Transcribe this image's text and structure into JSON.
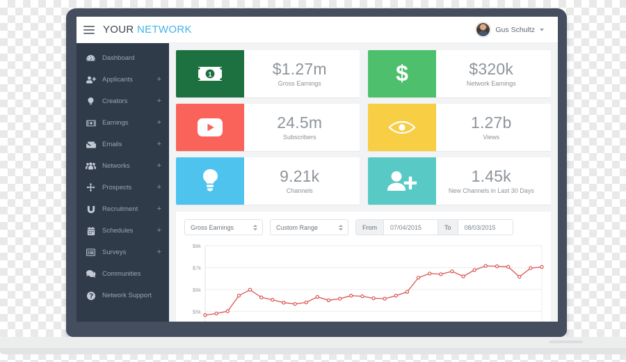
{
  "topbar": {
    "menu_icon": "hamburger-icon",
    "brand_primary": "YOUR",
    "brand_secondary": "NETWORK",
    "user_name": "Gus Schultz",
    "caret_icon": "chevron-down-icon"
  },
  "sidebar": {
    "items": [
      {
        "label": "Dashboard",
        "icon": "dashboard-icon",
        "expand": ""
      },
      {
        "label": "Applicants",
        "icon": "user-plus-icon",
        "expand": "+"
      },
      {
        "label": "Creators",
        "icon": "bulb-icon",
        "expand": "+"
      },
      {
        "label": "Earnings",
        "icon": "money-icon",
        "expand": "+"
      },
      {
        "label": "Emails",
        "icon": "envelope-icon",
        "expand": "+"
      },
      {
        "label": "Networks",
        "icon": "group-icon",
        "expand": "+"
      },
      {
        "label": "Prospects",
        "icon": "move-icon",
        "expand": "+"
      },
      {
        "label": "Recruitment",
        "icon": "magnet-icon",
        "expand": "+"
      },
      {
        "label": "Schedules",
        "icon": "calendar-icon",
        "expand": "+"
      },
      {
        "label": "Surveys",
        "icon": "list-alt-icon",
        "expand": "+"
      },
      {
        "label": "Communities",
        "icon": "comments-icon",
        "expand": ""
      },
      {
        "label": "Network Support",
        "icon": "question-icon",
        "expand": ""
      }
    ]
  },
  "cards": [
    {
      "value": "$1.27m",
      "label": "Gross Earnings",
      "icon": "money-bill-icon",
      "color": "#1d7141"
    },
    {
      "value": "$320k",
      "label": "Network Earnings",
      "icon": "dollar-icon",
      "color": "#4ec06d"
    },
    {
      "value": "24.5m",
      "label": "Subscribers",
      "icon": "youtube-icon",
      "color": "#fa6359"
    },
    {
      "value": "1.27b",
      "label": "Views",
      "icon": "eye-icon",
      "color": "#f7ce44"
    },
    {
      "value": "9.21k",
      "label": "Channels",
      "icon": "bulb-icon",
      "color": "#4ec3ee"
    },
    {
      "value": "1.45k",
      "label": "New Channels in Last 30 Days",
      "icon": "user-plus-icon",
      "color": "#58c9c4"
    }
  ],
  "filters": {
    "metric_value": "Gross Earnings",
    "range_value": "Custom Range",
    "from_label": "From",
    "from_value": "07/04/2015",
    "to_label": "To",
    "to_value": "08/03/2015"
  },
  "chart_data": {
    "type": "line",
    "title": "",
    "xlabel": "",
    "ylabel": "",
    "ylim": [
      4500,
      8000
    ],
    "grid": true,
    "legend": "none",
    "line_color": "#d9534f",
    "ytick_labels": [
      "$5k",
      "$6k",
      "$7k",
      "$8k"
    ],
    "ytick_values": [
      5000,
      6000,
      7000,
      8000
    ],
    "x": [
      1,
      2,
      3,
      4,
      5,
      6,
      7,
      8,
      9,
      10,
      11,
      12,
      13,
      14,
      15,
      16,
      17,
      18,
      19,
      20,
      21,
      22,
      23,
      24,
      25,
      26,
      27,
      28,
      29,
      30,
      31
    ],
    "series": [
      {
        "name": "Gross Earnings",
        "values": [
          4830,
          4900,
          5010,
          5720,
          5990,
          5640,
          5530,
          5400,
          5340,
          5410,
          5660,
          5510,
          5580,
          5720,
          5690,
          5600,
          5580,
          5720,
          5890,
          6540,
          6730,
          6700,
          6830,
          6600,
          6890,
          7080,
          7060,
          7040,
          6580,
          6980,
          7030
        ]
      }
    ]
  }
}
